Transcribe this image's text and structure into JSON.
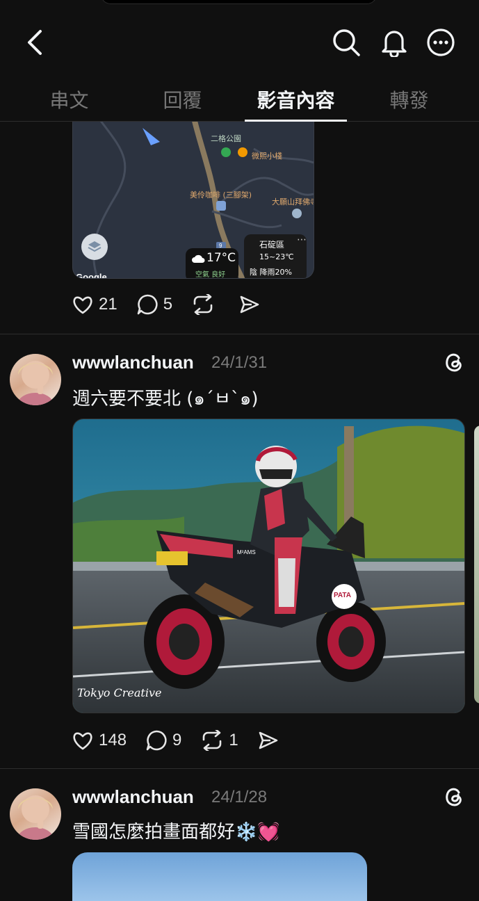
{
  "header": {
    "back_icon": "chevron-left-icon",
    "search_icon": "search-icon",
    "bell_icon": "bell-icon",
    "more_icon": "more-icon"
  },
  "tabs": [
    {
      "label": "串文",
      "active": false
    },
    {
      "label": "回覆",
      "active": false
    },
    {
      "label": "影音內容",
      "active": true
    },
    {
      "label": "轉發",
      "active": false
    }
  ],
  "map_card": {
    "labels": [
      "二格公園",
      "微熙小棧",
      "美伶咖啡 (三腳架)",
      "大願山拜佛寺"
    ],
    "road_marker": "9",
    "attribution": "Google",
    "weather_chip": {
      "temp": "17°C",
      "aqi": "空氣 良好"
    },
    "weather_card": {
      "district": "石碇區",
      "range": "15~23℃",
      "forecast": "陰 降雨20%"
    }
  },
  "posts": [
    {
      "actions": {
        "likes": "21",
        "replies": "5",
        "reposts": "",
        "share": ""
      }
    },
    {
      "username": "wwwlanchuan",
      "date": "24/1/31",
      "text": "週六要不要北 (๑´ㅂ`๑)",
      "photo": {
        "watermark": "Tokyo Creative",
        "plate_text": "M²AMS",
        "sticker": "PATA"
      },
      "actions": {
        "likes": "148",
        "replies": "9",
        "reposts": "1",
        "share": ""
      }
    },
    {
      "username": "wwwlanchuan",
      "date": "24/1/28",
      "text": "雪國怎麼拍畫面都好❄️💓"
    }
  ],
  "colors": {
    "background": "#101010",
    "text": "#f3f5f7",
    "muted": "#777777",
    "divider": "#2d2d2d"
  }
}
